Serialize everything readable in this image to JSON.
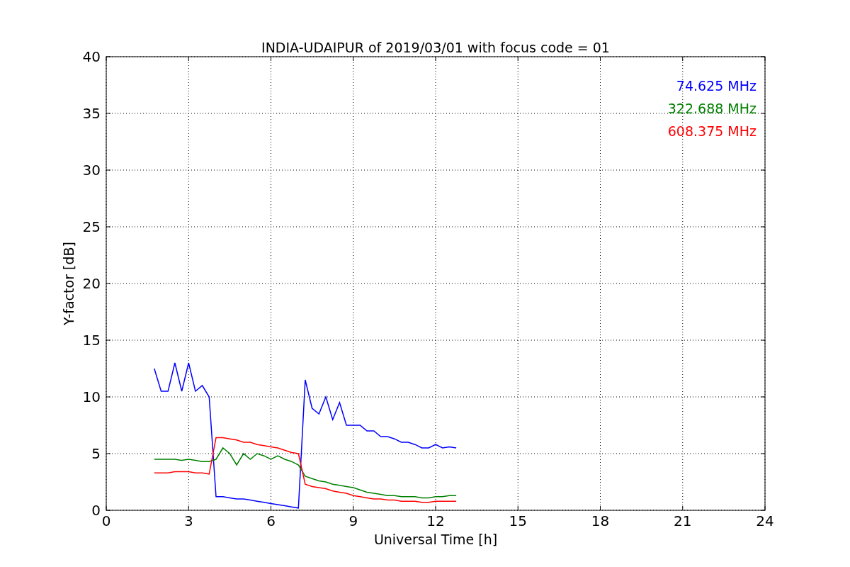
{
  "figure": {
    "chart_data": {
      "type": "line",
      "title": "INDIA-UDAIPUR of 2019/03/01 with focus code = 01",
      "xlabel": "Universal Time [h]",
      "ylabel": "Y-factor [dB]",
      "x": [
        1.75,
        2.0,
        2.25,
        2.5,
        2.75,
        3.0,
        3.25,
        3.5,
        3.75,
        4.0,
        4.25,
        4.5,
        4.75,
        5.0,
        5.25,
        5.5,
        5.75,
        6.0,
        6.25,
        6.5,
        6.75,
        7.0,
        7.25,
        7.5,
        7.75,
        8.0,
        8.25,
        8.5,
        8.75,
        9.0,
        9.25,
        9.5,
        9.75,
        10.0,
        10.25,
        10.5,
        10.75,
        11.0,
        11.25,
        11.5,
        11.75,
        12.0,
        12.25,
        12.5,
        12.75
      ],
      "series": [
        {
          "name": "74.625 MHz",
          "color": "#0000ff",
          "values": [
            12.5,
            10.5,
            10.5,
            13,
            10.5,
            13,
            10.5,
            11,
            10,
            1.2,
            1.2,
            1.1,
            1.0,
            1.0,
            0.9,
            0.8,
            0.7,
            0.6,
            0.5,
            0.4,
            0.3,
            0.2,
            11.5,
            9,
            8.5,
            10,
            8,
            9.5,
            7.5,
            7.5,
            7.5,
            7,
            7,
            6.5,
            6.5,
            6.3,
            6,
            6,
            5.8,
            5.5,
            5.5,
            5.8,
            5.5,
            5.6,
            5.5
          ]
        },
        {
          "name": "322.688 MHz",
          "color": "#008000",
          "values": [
            4.5,
            4.5,
            4.5,
            4.5,
            4.4,
            4.5,
            4.4,
            4.3,
            4.3,
            4.5,
            5.5,
            5,
            4,
            5,
            4.5,
            5,
            4.8,
            4.5,
            4.8,
            4.5,
            4.3,
            4.0,
            3.0,
            2.8,
            2.6,
            2.5,
            2.3,
            2.2,
            2.1,
            2.0,
            1.8,
            1.6,
            1.5,
            1.4,
            1.3,
            1.3,
            1.2,
            1.2,
            1.2,
            1.1,
            1.1,
            1.2,
            1.2,
            1.3,
            1.3
          ]
        },
        {
          "name": "608.375 MHz",
          "color": "#ff0000",
          "values": [
            3.3,
            3.3,
            3.3,
            3.4,
            3.4,
            3.4,
            3.3,
            3.3,
            3.2,
            6.4,
            6.4,
            6.3,
            6.2,
            6.0,
            6.0,
            5.8,
            5.7,
            5.6,
            5.5,
            5.3,
            5.1,
            5.0,
            2.3,
            2.1,
            2.0,
            1.9,
            1.7,
            1.6,
            1.5,
            1.3,
            1.2,
            1.1,
            1.0,
            1.0,
            0.9,
            0.9,
            0.8,
            0.8,
            0.8,
            0.7,
            0.7,
            0.8,
            0.8,
            0.8,
            0.8
          ]
        }
      ],
      "xlim": [
        0,
        24
      ],
      "ylim": [
        0,
        40
      ],
      "xticks": [
        0,
        3,
        6,
        9,
        12,
        15,
        18,
        21,
        24
      ],
      "yticks": [
        0,
        5,
        10,
        15,
        20,
        25,
        30,
        35,
        40
      ],
      "grid": true
    }
  }
}
